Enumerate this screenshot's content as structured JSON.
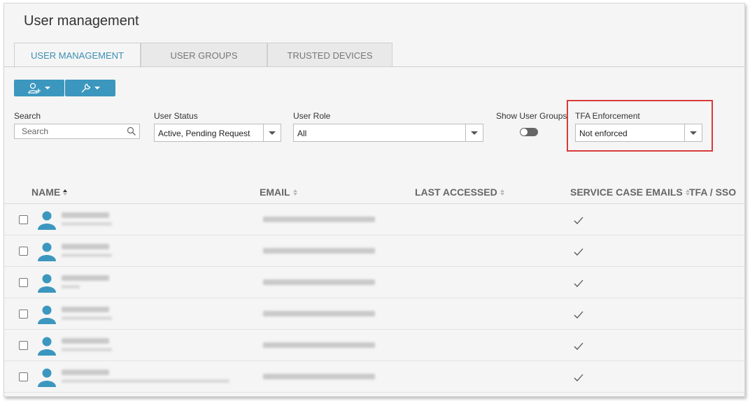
{
  "header": {
    "title": "User management"
  },
  "tabs": [
    {
      "label": "USER MANAGEMENT",
      "active": true
    },
    {
      "label": "USER GROUPS",
      "active": false
    },
    {
      "label": "TRUSTED DEVICES",
      "active": false
    }
  ],
  "toolbar": {
    "add_user_icon": "add-user-icon",
    "tools_icon": "wrench-icon"
  },
  "filters": {
    "search": {
      "label": "Search",
      "placeholder": "Search"
    },
    "user_status": {
      "label": "User Status",
      "value": "Active, Pending Request"
    },
    "user_role": {
      "label": "User Role",
      "value": "All"
    },
    "show_user_groups": {
      "label": "Show User Groups",
      "on": false
    },
    "tfa": {
      "label": "TFA Enforcement",
      "value": "Not enforced"
    }
  },
  "table": {
    "columns": [
      "NAME",
      "EMAIL",
      "LAST ACCESSED",
      "SERVICE CASE EMAILS",
      "TFA / SSO"
    ],
    "rows": [
      {
        "service_case_emails": "✓"
      },
      {
        "service_case_emails": "✓"
      },
      {
        "service_case_emails": "✓"
      },
      {
        "service_case_emails": "✓"
      },
      {
        "service_case_emails": "✓"
      },
      {
        "service_case_emails": "✓"
      }
    ]
  },
  "colors": {
    "accent": "#3c97bf",
    "highlight": "#d93a3a",
    "avatar": "#3c97bf"
  }
}
